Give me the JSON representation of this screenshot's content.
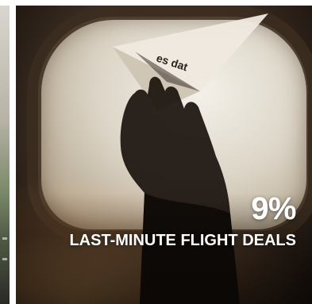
{
  "promo_card": {
    "discount": "9%",
    "title": "LAST-MINUTE FLIGHT DEALS",
    "image_subject": "paper-plane-through-airplane-window",
    "paper_plane_text": "es dat"
  },
  "colors": {
    "text": "#ffffff",
    "window_light": "#f4f1ea",
    "interior_dark": "#140e0a",
    "sunlight": "#ffbe6e"
  }
}
